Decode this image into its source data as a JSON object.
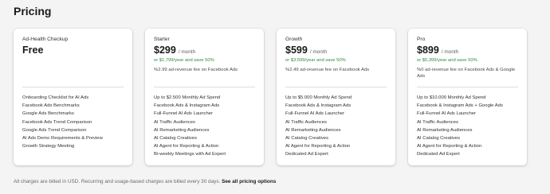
{
  "title": "Pricing",
  "plans": [
    {
      "name": "Ad-Health Checkup",
      "price": "Free",
      "period": "",
      "savings": "",
      "fee": "",
      "features": [
        "Onboarding Checklist for AI Ads",
        "Facebook Ads Benchmarks",
        "Google Ads Benchmarks",
        "Facebook Ads Trend Comparison",
        "Google Ads Trend Comparison",
        "AI Ads Demo Requirements & Preview",
        "Growth Strategy Meeting"
      ]
    },
    {
      "name": "Starter",
      "price": "$299",
      "period": "/ month",
      "savings": "or $1,799/year and save 50%",
      "fee": "%2.99 ad-revenue fee on Facebook Ads",
      "features": [
        "Up to $2.500 Monthly Ad Spend",
        "Facebook Ads & Instagram Ads",
        "Full-Funnel AI Ads Launcher",
        "AI Traffic Audiences",
        "AI Remarketing Audiences",
        "AI Catalog Creatives",
        "AI Agent for Reporting & Action",
        "Bi-weekly Meetings with Ad Expert"
      ]
    },
    {
      "name": "Growth",
      "price": "$599",
      "period": "/ month",
      "savings": "or $3,599/year and save 50%",
      "fee": "%2.49 ad-revenue fee on Facebook Ads",
      "features": [
        "Up to $5.000 Monthly Ad Spend",
        "Facebook Ads & Instagram Ads",
        "Full-Funnel AI Ads Launcher",
        "AI Traffic Audiences",
        "AI Remarketing Audiences",
        "AI Catalog Creatives",
        "AI Agent for Reporting & Action",
        "Dedicated Ad Expert"
      ]
    },
    {
      "name": "Pro",
      "price": "$899",
      "period": "/ month",
      "savings": "or $5,399/year and save 50%",
      "fee": "%0 ad-revenue fee on Facebook Ads & Google Ads",
      "features": [
        "Up to $10.000 Monthly Ad Spend",
        "Facebook & Instagram Ads + Google Ads",
        "Full-Funnel AI Ads Launcher",
        "AI Traffic Audiences",
        "AI Remarketing Audiences",
        "AI Catalog Creatives",
        "AI Agent for Reporting & Action",
        "Dedicated Ad Expert"
      ]
    }
  ],
  "footer": {
    "note": "All charges are billed in USD. Recurring and usage-based charges are billed every 30 days.",
    "link": "See all pricing options"
  },
  "colors": {
    "savings_green": "#2e8a3d",
    "background": "#f4f4f4",
    "card": "#ffffff"
  }
}
